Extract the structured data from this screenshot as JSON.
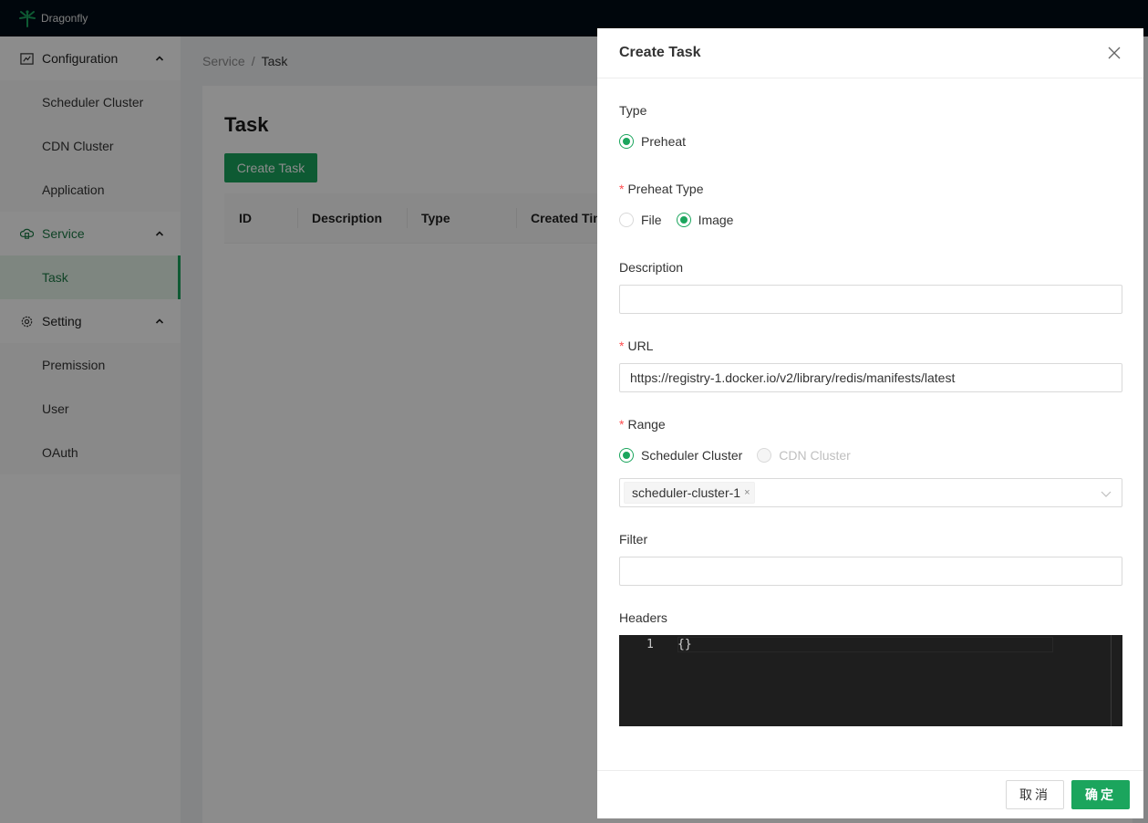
{
  "app": {
    "name": "Dragonfly"
  },
  "sidebar": {
    "groups": [
      {
        "label": "Configuration",
        "icon": "line-chart-icon",
        "items": [
          {
            "label": "Scheduler Cluster"
          },
          {
            "label": "CDN Cluster"
          },
          {
            "label": "Application"
          }
        ]
      },
      {
        "label": "Service",
        "icon": "cloud-server-icon",
        "active": true,
        "items": [
          {
            "label": "Task",
            "active": true
          }
        ]
      },
      {
        "label": "Setting",
        "icon": "gear-icon",
        "items": [
          {
            "label": "Premission"
          },
          {
            "label": "User"
          },
          {
            "label": "OAuth"
          }
        ]
      }
    ]
  },
  "breadcrumb": {
    "parent": "Service",
    "separator": "/",
    "current": "Task"
  },
  "page": {
    "title": "Task",
    "create_button": "Create Task",
    "table": {
      "columns": [
        "ID",
        "Description",
        "Type",
        "Created Tim"
      ]
    }
  },
  "drawer": {
    "title": "Create Task",
    "type": {
      "label": "Type",
      "options": [
        {
          "label": "Preheat",
          "checked": true
        }
      ]
    },
    "preheat_type": {
      "label": "Preheat Type",
      "required": "*",
      "options": [
        {
          "label": "File",
          "checked": false
        },
        {
          "label": "Image",
          "checked": true
        }
      ]
    },
    "description": {
      "label": "Description",
      "value": ""
    },
    "url": {
      "label": "URL",
      "required": "*",
      "value": "https://registry-1.docker.io/v2/library/redis/manifests/latest"
    },
    "range": {
      "label": "Range",
      "required": "*",
      "options": [
        {
          "label": "Scheduler Cluster",
          "checked": true
        },
        {
          "label": "CDN Cluster",
          "checked": false,
          "disabled": true
        }
      ],
      "selected_tags": [
        "scheduler-cluster-1"
      ],
      "tag_close": "×"
    },
    "filter": {
      "label": "Filter",
      "value": ""
    },
    "headers": {
      "label": "Headers",
      "line_number": "1",
      "code": "{}"
    },
    "footer": {
      "cancel": "取消",
      "ok": "确定"
    }
  },
  "colors": {
    "primary": "#1ba55d",
    "topbar": "#000c17",
    "required": "#ff4d4f"
  }
}
